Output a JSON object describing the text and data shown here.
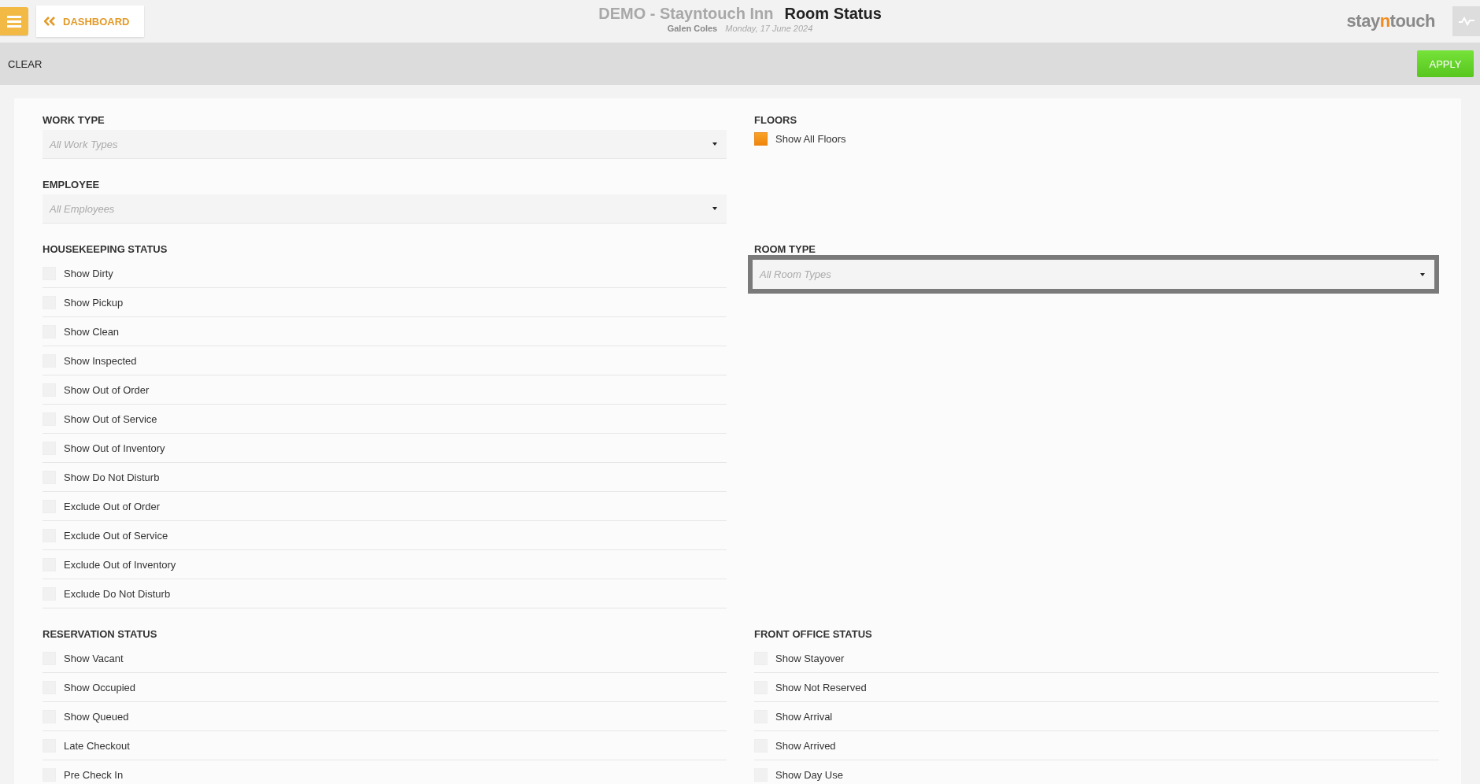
{
  "header": {
    "back_button": "DASHBOARD",
    "hotel": "DEMO - Stayntouch Inn",
    "page_title": "Room Status",
    "user": "Galen Coles",
    "date": "Monday, 17 June 2024",
    "logo": [
      {
        "text": "stay",
        "accent": false
      },
      {
        "text": "n",
        "accent": true
      },
      {
        "text": "touch",
        "accent": false
      }
    ]
  },
  "toolbar": {
    "clear": "CLEAR",
    "apply": "APPLY"
  },
  "filters": {
    "left_top": [
      {
        "title": "WORK TYPE",
        "placeholder": "All Work Types",
        "focused": false
      },
      {
        "title": "EMPLOYEE",
        "placeholder": "All Employees",
        "focused": false
      }
    ],
    "floors": {
      "title": "FLOORS",
      "options": [
        {
          "label": "Show All Floors",
          "checked": true
        }
      ]
    },
    "housekeeping": {
      "title": "HOUSEKEEPING STATUS",
      "options": [
        {
          "label": "Show Dirty",
          "checked": false
        },
        {
          "label": "Show Pickup",
          "checked": false
        },
        {
          "label": "Show Clean",
          "checked": false
        },
        {
          "label": "Show Inspected",
          "checked": false
        },
        {
          "label": "Show Out of Order",
          "checked": false
        },
        {
          "label": "Show Out of Service",
          "checked": false
        },
        {
          "label": "Show Out of Inventory",
          "checked": false
        },
        {
          "label": "Show Do Not Disturb",
          "checked": false
        },
        {
          "label": "Exclude Out of Order",
          "checked": false
        },
        {
          "label": "Exclude Out of Service",
          "checked": false
        },
        {
          "label": "Exclude Out of Inventory",
          "checked": false
        },
        {
          "label": "Exclude Do Not Disturb",
          "checked": false
        }
      ]
    },
    "room_type": {
      "title": "ROOM TYPE",
      "placeholder": "All Room Types",
      "focused": true
    },
    "reservation": {
      "title": "RESERVATION STATUS",
      "options": [
        {
          "label": "Show Vacant",
          "checked": false
        },
        {
          "label": "Show Occupied",
          "checked": false
        },
        {
          "label": "Show Queued",
          "checked": false
        },
        {
          "label": "Late Checkout",
          "checked": false
        },
        {
          "label": "Pre Check In",
          "checked": false
        }
      ]
    },
    "front_office": {
      "title": "FRONT OFFICE STATUS",
      "options": [
        {
          "label": "Show Stayover",
          "checked": false
        },
        {
          "label": "Show Not Reserved",
          "checked": false
        },
        {
          "label": "Show Arrival",
          "checked": false
        },
        {
          "label": "Show Arrived",
          "checked": false
        },
        {
          "label": "Show Day Use",
          "checked": false
        }
      ]
    }
  }
}
